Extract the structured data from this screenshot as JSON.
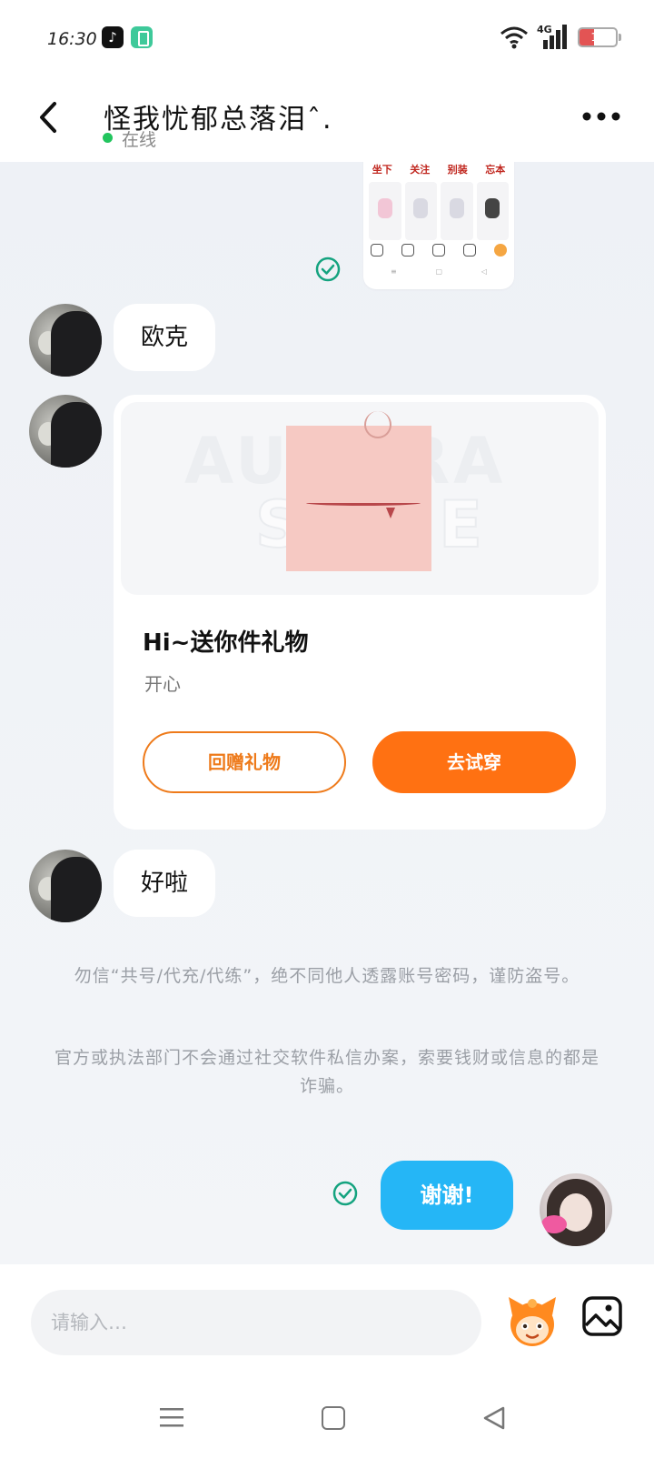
{
  "status_bar": {
    "time": "16:30",
    "tiktok_glyph": "♪",
    "network": "4G",
    "battery_level": "13",
    "battery_color": "#e35454"
  },
  "header": {
    "back_icon": "chevron-left-icon",
    "title": "怪我忧郁总落泪ˆ.",
    "status": "在线",
    "more_icon": "more-horizontal-icon"
  },
  "shared_image": {
    "tabs": [
      "坐下",
      "关注",
      "别装",
      "忘本"
    ],
    "nav_bar_symbols": [
      "≡",
      "▢",
      "◁"
    ]
  },
  "messages": {
    "m1": "欧克",
    "gift_card": {
      "title": "Hi~送你件礼物",
      "subtitle": "开心",
      "button_return": "回赠礼物",
      "button_try": "去试穿",
      "watermark_top": "AURORA",
      "watermark_bottom": "SERIE"
    },
    "m2": "好啦",
    "notice_1": "勿信“共号/代充/代练”，绝不同他人透露账号密码，谨防盗号。",
    "notice_2": "官方或执法部门不会通过社交软件私信办案，索要钱财或信息的都是诈骗。",
    "my_message": "谢谢!"
  },
  "input_bar": {
    "placeholder": "请输入…",
    "emoji_icon": "mascot-emoji-icon",
    "image_icon": "image-picker-icon"
  },
  "colors": {
    "accent_orange": "#ff7112",
    "bubble_blue": "#25b6f6",
    "online_green": "#22c55e"
  }
}
